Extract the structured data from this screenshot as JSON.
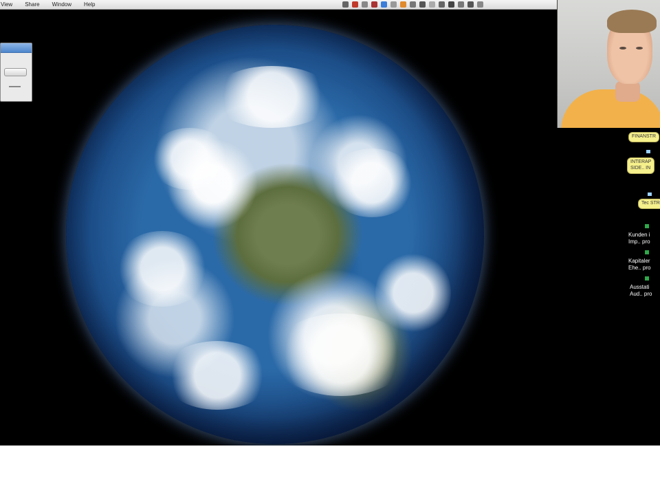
{
  "menubar": {
    "items": [
      "View",
      "Share",
      "Window",
      "Help"
    ]
  },
  "tray": {
    "icons": [
      {
        "name": "app-icon-1",
        "color": "#666666"
      },
      {
        "name": "app-icon-2",
        "color": "#c0392b"
      },
      {
        "name": "app-icon-3",
        "color": "#888888"
      },
      {
        "name": "app-icon-4",
        "color": "#aa3333"
      },
      {
        "name": "app-icon-5",
        "color": "#3b7dd8"
      },
      {
        "name": "app-icon-6",
        "color": "#999999"
      },
      {
        "name": "app-icon-7",
        "color": "#e08a2e"
      },
      {
        "name": "app-icon-8",
        "color": "#777777"
      },
      {
        "name": "app-icon-9",
        "color": "#555555"
      },
      {
        "name": "app-icon-10",
        "color": "#aaaaaa"
      },
      {
        "name": "app-icon-11",
        "color": "#666666"
      },
      {
        "name": "app-icon-12",
        "color": "#444444"
      },
      {
        "name": "app-icon-13",
        "color": "#777777"
      },
      {
        "name": "app-icon-14",
        "color": "#555555"
      },
      {
        "name": "app-icon-15",
        "color": "#888888"
      }
    ]
  },
  "mindmap": {
    "node1": "FINANSTR",
    "node2_line1": "INTERAP",
    "node2_line2": "SIDE.. IN",
    "node3": "Tec STR",
    "item1_line1": "Kunden i",
    "item1_line2": "Imp.. pro",
    "item2_line1": "Kapitaler",
    "item2_line2": "Ehe.. pro",
    "item3_line1": "Ausstati",
    "item3_line2": "Aud.. pro"
  },
  "colors": {
    "pill": "#f6f08c",
    "connector": "#9ad0ff",
    "square": "#2ea84a"
  }
}
